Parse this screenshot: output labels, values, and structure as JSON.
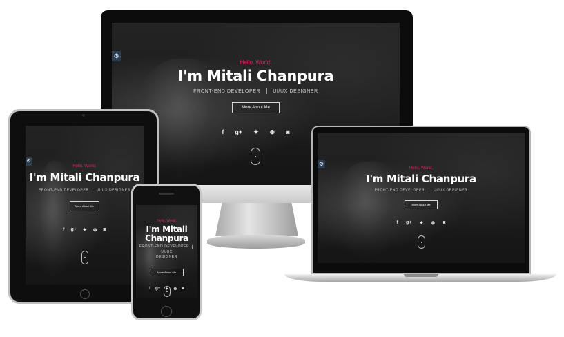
{
  "hero": {
    "greeting": "Hello, World.",
    "name": "I'm Mitali Chanpura",
    "name_line1": "I'm Mitali",
    "name_line2": "Chanpura",
    "role_1": "FRONT-END DEVELOPER",
    "role_2": "UI/UX DESIGNER",
    "role_2_wrapped": "DESIGNER",
    "role_2_prefix": "UI/UX",
    "cta_label": "More About Me"
  },
  "socials": [
    {
      "icon": "facebook-icon",
      "glyph": "f"
    },
    {
      "icon": "google-plus-icon",
      "glyph": "g+"
    },
    {
      "icon": "twitter-icon",
      "glyph": "✦"
    },
    {
      "icon": "dribbble-icon",
      "glyph": "⊛"
    },
    {
      "icon": "instagram-icon",
      "glyph": "◙"
    }
  ],
  "toggle": {
    "icon": "settings-icon",
    "glyph": "⚙"
  },
  "colors": {
    "accent": "#e0245e",
    "toggle_bg": "#2c3e50",
    "background": "#1b1b1b"
  }
}
